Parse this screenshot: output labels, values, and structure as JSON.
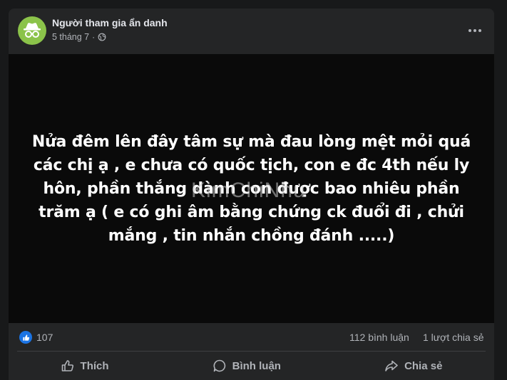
{
  "post": {
    "author": "Người tham gia ẩn danh",
    "date": "5 tháng 7",
    "separator": "·",
    "privacy_icon": "globe-icon",
    "avatar_icon": "anonymous-incognito-icon",
    "avatar_color": "#8bc34a",
    "text": "Nửa đêm lên đây tâm sự mà đau lòng mệt mỏi quá các chị ạ , e chưa có quốc tịch, con e đc 4th nếu ly hôn, phần thắng dành con được bao nhiêu phần trăm ạ ( e có ghi âm bằng chứng ck đuổi đi , chửi mắng , tin nhắn chồng đánh .....)",
    "watermark": "KimChiNhu"
  },
  "stats": {
    "likes": "107",
    "comments": "112 bình luận",
    "shares": "1 lượt chia sẻ",
    "like_color": "#1b74e4"
  },
  "actions": {
    "like": "Thích",
    "comment": "Bình luận",
    "share": "Chia sẻ"
  }
}
